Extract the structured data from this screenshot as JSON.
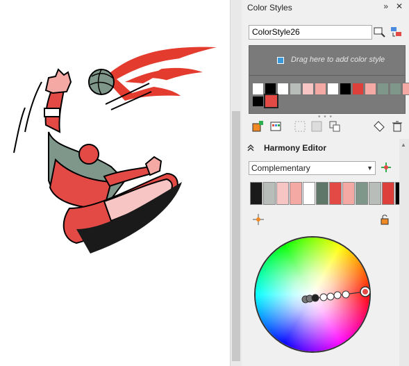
{
  "panel": {
    "title": "Color Styles",
    "expand_icon": "double-chevron-right-icon",
    "close_icon": "close-icon",
    "name_value": "ColorStyle26",
    "dropzone_text": "Drag here to add color style",
    "harmony_title": "Harmony Editor",
    "harmony_type": "Complementary"
  },
  "style_swatches": [
    "#ffffff",
    "#000000",
    "#ffffff",
    "#b8bdb9",
    "#f7c6c4",
    "#f5a9a5",
    "#ffffff",
    "#000000",
    "#dd3f3b",
    "#f5a9a5",
    "#7f978a",
    "#7f978a",
    "#f5a9a5",
    "#e34a45"
  ],
  "harmony_swatches": [
    "#1a1a1a",
    "#b8bdb9",
    "#f7c6c4",
    "#f5a9a5",
    "#ffffff",
    "#5e7768",
    "#e34a45",
    "#f5a9a5",
    "#7f978a",
    "#b8bdb9",
    "#dd3f3b",
    "#000000",
    "#e32c29"
  ],
  "colors": {
    "dropzone_bg": "#7a7a7a",
    "accent_red": "#e34a45",
    "panel_bg": "#f0f0f0"
  }
}
